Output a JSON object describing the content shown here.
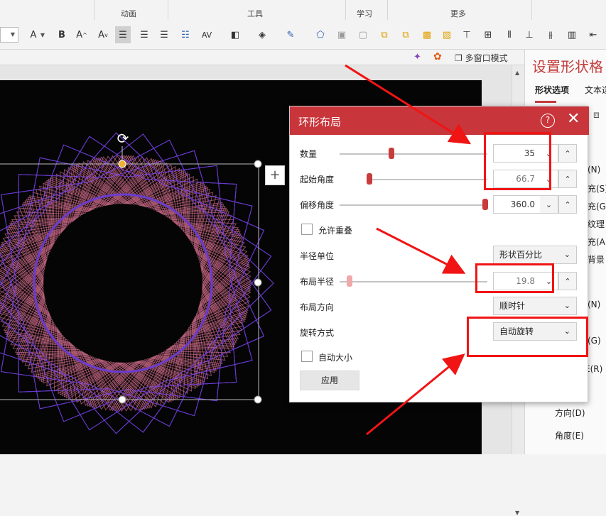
{
  "ribbon": {
    "groups": [
      "动画",
      "工具",
      "学习",
      "更多"
    ],
    "font_color_letter": "A",
    "bold_letter": "B",
    "grow_font": "A",
    "shrink_font": "A"
  },
  "subbar": {
    "multiwindow_label": "多窗口模式"
  },
  "side_panel": {
    "title": "设置形状格",
    "tabs": [
      "形状选项",
      "文本选"
    ],
    "items": [
      "(N)",
      "充(S)",
      "充(G)",
      "纹理",
      "充(A)",
      "背景",
      "(N)",
      "(G)",
      "E(R)",
      "方向(D)",
      "角度(E)"
    ]
  },
  "dialog": {
    "title": "环形布局",
    "help": "?",
    "close": "✕",
    "count_label": "数量",
    "count_value": "35",
    "start_angle_label": "起始角度",
    "start_angle_value": "66.7",
    "offset_angle_label": "偏移角度",
    "offset_angle_value": "360.0",
    "allow_overlap_label": "允许重叠",
    "radius_unit_label": "半径单位",
    "radius_unit_value": "形状百分比",
    "layout_radius_label": "布局半径",
    "layout_radius_value": "19.8",
    "layout_direction_label": "布局方向",
    "layout_direction_value": "顺时针",
    "rotation_label": "旋转方式",
    "rotation_value": "自动旋转",
    "auto_size_label": "自动大小",
    "apply_label": "应用"
  },
  "colors": {
    "accent": "#c8353b",
    "annotation": "#f01414",
    "spiro_pink": "#e8789a",
    "spiro_purple": "#6a3cd0"
  }
}
